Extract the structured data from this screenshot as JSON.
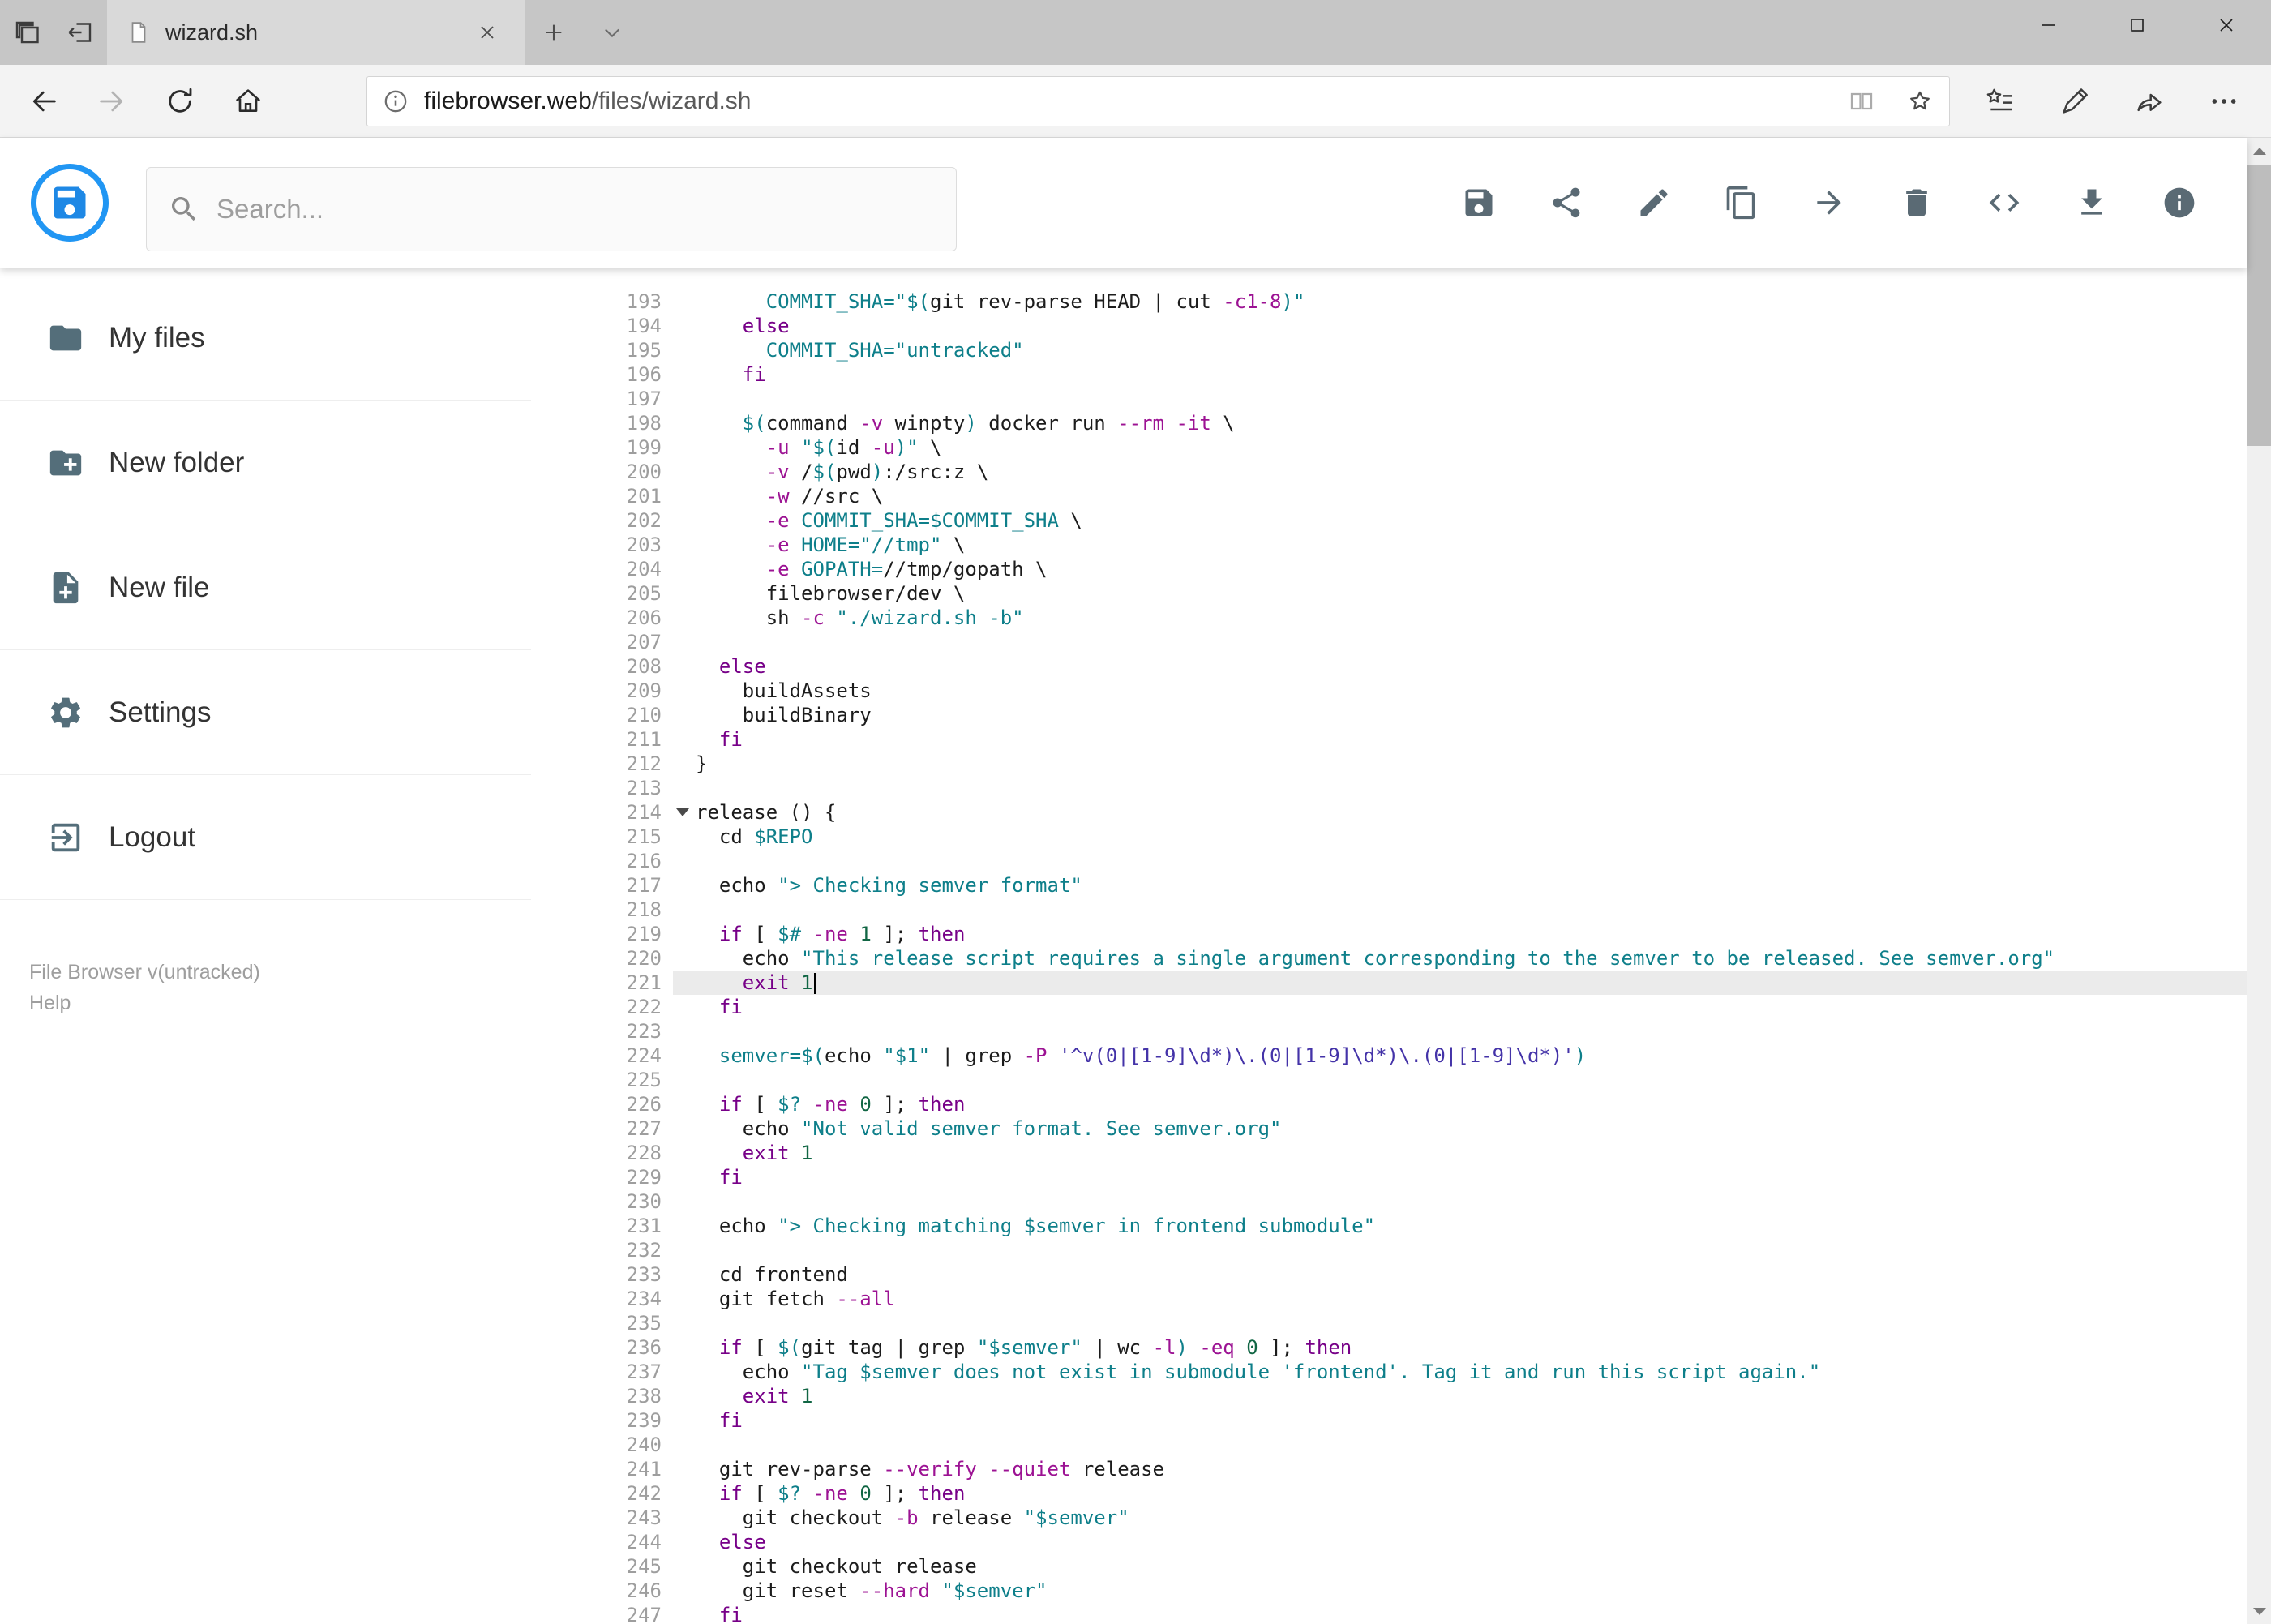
{
  "browser": {
    "tab": {
      "title": "wizard.sh"
    },
    "url": {
      "domain": "filebrowser.web",
      "path": "/files/wizard.sh"
    }
  },
  "header": {
    "search_placeholder": "Search...",
    "toolbar_icons": [
      "save",
      "share",
      "edit",
      "copy",
      "move",
      "delete",
      "code",
      "download",
      "info"
    ]
  },
  "sidebar": {
    "items": [
      {
        "label": "My files",
        "icon": "folder"
      },
      {
        "label": "New folder",
        "icon": "create-new-folder"
      },
      {
        "label": "New file",
        "icon": "note-add"
      },
      {
        "label": "Settings",
        "icon": "settings-gear"
      },
      {
        "label": "Logout",
        "icon": "exit-to-app"
      }
    ],
    "footer": {
      "version": "File Browser v(untracked)",
      "help": "Help"
    }
  },
  "editor": {
    "active_line": 221,
    "cursor_line": 221,
    "fold_markers": [
      214
    ],
    "lines": [
      {
        "n": 193,
        "seg": [
          [
            "p",
            "      "
          ],
          [
            "v",
            "COMMIT_SHA="
          ],
          [
            "s",
            "\"$("
          ],
          [
            "p",
            "git rev-parse HEAD | cut "
          ],
          [
            "o",
            "-c1-8"
          ],
          [
            "s",
            ")\""
          ]
        ]
      },
      {
        "n": 194,
        "seg": [
          [
            "p",
            "    "
          ],
          [
            "k",
            "else"
          ]
        ]
      },
      {
        "n": 195,
        "seg": [
          [
            "p",
            "      "
          ],
          [
            "v",
            "COMMIT_SHA="
          ],
          [
            "s",
            "\"untracked\""
          ]
        ]
      },
      {
        "n": 196,
        "seg": [
          [
            "p",
            "    "
          ],
          [
            "k",
            "fi"
          ]
        ]
      },
      {
        "n": 197,
        "seg": []
      },
      {
        "n": 198,
        "seg": [
          [
            "p",
            "    "
          ],
          [
            "s",
            "$("
          ],
          [
            "p",
            "command "
          ],
          [
            "o",
            "-v"
          ],
          [
            "p",
            " winpty"
          ],
          [
            "s",
            ")"
          ],
          [
            "p",
            " docker run "
          ],
          [
            "o",
            "--rm"
          ],
          [
            "p",
            " "
          ],
          [
            "o",
            "-it"
          ],
          [
            "p",
            " \\"
          ]
        ]
      },
      {
        "n": 199,
        "seg": [
          [
            "p",
            "      "
          ],
          [
            "o",
            "-u"
          ],
          [
            "p",
            " "
          ],
          [
            "s",
            "\"$("
          ],
          [
            "p",
            "id "
          ],
          [
            "o",
            "-u"
          ],
          [
            "s",
            ")\""
          ],
          [
            "p",
            " \\"
          ]
        ]
      },
      {
        "n": 200,
        "seg": [
          [
            "p",
            "      "
          ],
          [
            "o",
            "-v"
          ],
          [
            "p",
            " /"
          ],
          [
            "s",
            "$("
          ],
          [
            "p",
            "pwd"
          ],
          [
            "s",
            ")"
          ],
          [
            "p",
            ":/src:z \\"
          ]
        ]
      },
      {
        "n": 201,
        "seg": [
          [
            "p",
            "      "
          ],
          [
            "o",
            "-w"
          ],
          [
            "p",
            " //src \\"
          ]
        ]
      },
      {
        "n": 202,
        "seg": [
          [
            "p",
            "      "
          ],
          [
            "o",
            "-e"
          ],
          [
            "p",
            " "
          ],
          [
            "v",
            "COMMIT_SHA=$COMMIT_SHA"
          ],
          [
            "p",
            " \\"
          ]
        ]
      },
      {
        "n": 203,
        "seg": [
          [
            "p",
            "      "
          ],
          [
            "o",
            "-e"
          ],
          [
            "p",
            " "
          ],
          [
            "v",
            "HOME="
          ],
          [
            "s",
            "\"//tmp\""
          ],
          [
            "p",
            " \\"
          ]
        ]
      },
      {
        "n": 204,
        "seg": [
          [
            "p",
            "      "
          ],
          [
            "o",
            "-e"
          ],
          [
            "p",
            " "
          ],
          [
            "v",
            "GOPATH="
          ],
          [
            "p",
            "//tmp/gopath \\"
          ]
        ]
      },
      {
        "n": 205,
        "seg": [
          [
            "p",
            "      filebrowser/dev \\"
          ]
        ]
      },
      {
        "n": 206,
        "seg": [
          [
            "p",
            "      sh "
          ],
          [
            "o",
            "-c"
          ],
          [
            "p",
            " "
          ],
          [
            "s",
            "\"./wizard.sh -b\""
          ]
        ]
      },
      {
        "n": 207,
        "seg": []
      },
      {
        "n": 208,
        "seg": [
          [
            "p",
            "  "
          ],
          [
            "k",
            "else"
          ]
        ]
      },
      {
        "n": 209,
        "seg": [
          [
            "p",
            "    buildAssets"
          ]
        ]
      },
      {
        "n": 210,
        "seg": [
          [
            "p",
            "    buildBinary"
          ]
        ]
      },
      {
        "n": 211,
        "seg": [
          [
            "p",
            "  "
          ],
          [
            "k",
            "fi"
          ]
        ]
      },
      {
        "n": 212,
        "seg": [
          [
            "p",
            "}"
          ]
        ]
      },
      {
        "n": 213,
        "seg": []
      },
      {
        "n": 214,
        "seg": [
          [
            "p",
            "release () {"
          ]
        ]
      },
      {
        "n": 215,
        "seg": [
          [
            "p",
            "  cd "
          ],
          [
            "v",
            "$REPO"
          ]
        ]
      },
      {
        "n": 216,
        "seg": []
      },
      {
        "n": 217,
        "seg": [
          [
            "p",
            "  echo "
          ],
          [
            "s",
            "\"> Checking semver format\""
          ]
        ]
      },
      {
        "n": 218,
        "seg": []
      },
      {
        "n": 219,
        "seg": [
          [
            "p",
            "  "
          ],
          [
            "k",
            "if"
          ],
          [
            "p",
            " [ "
          ],
          [
            "v",
            "$#"
          ],
          [
            "p",
            " "
          ],
          [
            "o",
            "-ne"
          ],
          [
            "p",
            " "
          ],
          [
            "n",
            "1"
          ],
          [
            "p",
            " ]; "
          ],
          [
            "k",
            "then"
          ]
        ]
      },
      {
        "n": 220,
        "seg": [
          [
            "p",
            "    echo "
          ],
          [
            "s",
            "\"This release script requires a single argument corresponding to the semver to be released. See semver.org\""
          ]
        ]
      },
      {
        "n": 221,
        "seg": [
          [
            "p",
            "    "
          ],
          [
            "k",
            "exit"
          ],
          [
            "p",
            " "
          ],
          [
            "n",
            "1"
          ]
        ]
      },
      {
        "n": 222,
        "seg": [
          [
            "p",
            "  "
          ],
          [
            "k",
            "fi"
          ]
        ]
      },
      {
        "n": 223,
        "seg": []
      },
      {
        "n": 224,
        "seg": [
          [
            "p",
            "  "
          ],
          [
            "v",
            "semver="
          ],
          [
            "s",
            "$("
          ],
          [
            "p",
            "echo "
          ],
          [
            "s",
            "\"$1\""
          ],
          [
            "p",
            " | grep "
          ],
          [
            "o",
            "-P"
          ],
          [
            "p",
            " "
          ],
          [
            "r",
            "'^v(0|[1-9]\\d*)\\.(0|[1-9]\\d*)\\.(0|[1-9]\\d*)'"
          ],
          [
            "s",
            ")"
          ]
        ]
      },
      {
        "n": 225,
        "seg": []
      },
      {
        "n": 226,
        "seg": [
          [
            "p",
            "  "
          ],
          [
            "k",
            "if"
          ],
          [
            "p",
            " [ "
          ],
          [
            "v",
            "$?"
          ],
          [
            "p",
            " "
          ],
          [
            "o",
            "-ne"
          ],
          [
            "p",
            " "
          ],
          [
            "n",
            "0"
          ],
          [
            "p",
            " ]; "
          ],
          [
            "k",
            "then"
          ]
        ]
      },
      {
        "n": 227,
        "seg": [
          [
            "p",
            "    echo "
          ],
          [
            "s",
            "\"Not valid semver format. See semver.org\""
          ]
        ]
      },
      {
        "n": 228,
        "seg": [
          [
            "p",
            "    "
          ],
          [
            "k",
            "exit"
          ],
          [
            "p",
            " "
          ],
          [
            "n",
            "1"
          ]
        ]
      },
      {
        "n": 229,
        "seg": [
          [
            "p",
            "  "
          ],
          [
            "k",
            "fi"
          ]
        ]
      },
      {
        "n": 230,
        "seg": []
      },
      {
        "n": 231,
        "seg": [
          [
            "p",
            "  echo "
          ],
          [
            "s",
            "\"> Checking matching "
          ],
          [
            "v",
            "$semver"
          ],
          [
            "s",
            " in frontend submodule\""
          ]
        ]
      },
      {
        "n": 232,
        "seg": []
      },
      {
        "n": 233,
        "seg": [
          [
            "p",
            "  cd frontend"
          ]
        ]
      },
      {
        "n": 234,
        "seg": [
          [
            "p",
            "  git fetch "
          ],
          [
            "o",
            "--all"
          ]
        ]
      },
      {
        "n": 235,
        "seg": []
      },
      {
        "n": 236,
        "seg": [
          [
            "p",
            "  "
          ],
          [
            "k",
            "if"
          ],
          [
            "p",
            " [ "
          ],
          [
            "s",
            "$("
          ],
          [
            "p",
            "git tag | grep "
          ],
          [
            "s",
            "\"$semver\""
          ],
          [
            "p",
            " | wc "
          ],
          [
            "o",
            "-l"
          ],
          [
            "s",
            ")"
          ],
          [
            "p",
            " "
          ],
          [
            "o",
            "-eq"
          ],
          [
            "p",
            " "
          ],
          [
            "n",
            "0"
          ],
          [
            "p",
            " ]; "
          ],
          [
            "k",
            "then"
          ]
        ]
      },
      {
        "n": 237,
        "seg": [
          [
            "p",
            "    echo "
          ],
          [
            "s",
            "\"Tag "
          ],
          [
            "v",
            "$semver"
          ],
          [
            "s",
            " does not exist in submodule 'frontend'. Tag it and run this script again.\""
          ]
        ]
      },
      {
        "n": 238,
        "seg": [
          [
            "p",
            "    "
          ],
          [
            "k",
            "exit"
          ],
          [
            "p",
            " "
          ],
          [
            "n",
            "1"
          ]
        ]
      },
      {
        "n": 239,
        "seg": [
          [
            "p",
            "  "
          ],
          [
            "k",
            "fi"
          ]
        ]
      },
      {
        "n": 240,
        "seg": []
      },
      {
        "n": 241,
        "seg": [
          [
            "p",
            "  git rev-parse "
          ],
          [
            "o",
            "--verify"
          ],
          [
            "p",
            " "
          ],
          [
            "o",
            "--quiet"
          ],
          [
            "p",
            " release"
          ]
        ]
      },
      {
        "n": 242,
        "seg": [
          [
            "p",
            "  "
          ],
          [
            "k",
            "if"
          ],
          [
            "p",
            " [ "
          ],
          [
            "v",
            "$?"
          ],
          [
            "p",
            " "
          ],
          [
            "o",
            "-ne"
          ],
          [
            "p",
            " "
          ],
          [
            "n",
            "0"
          ],
          [
            "p",
            " ]; "
          ],
          [
            "k",
            "then"
          ]
        ]
      },
      {
        "n": 243,
        "seg": [
          [
            "p",
            "    git checkout "
          ],
          [
            "o",
            "-b"
          ],
          [
            "p",
            " release "
          ],
          [
            "s",
            "\"$semver\""
          ]
        ]
      },
      {
        "n": 244,
        "seg": [
          [
            "p",
            "  "
          ],
          [
            "k",
            "else"
          ]
        ]
      },
      {
        "n": 245,
        "seg": [
          [
            "p",
            "    git checkout release"
          ]
        ]
      },
      {
        "n": 246,
        "seg": [
          [
            "p",
            "    git reset "
          ],
          [
            "o",
            "--hard"
          ],
          [
            "p",
            " "
          ],
          [
            "s",
            "\"$semver\""
          ]
        ]
      },
      {
        "n": 247,
        "seg": [
          [
            "p",
            "  "
          ],
          [
            "k",
            "fi"
          ]
        ]
      }
    ]
  }
}
